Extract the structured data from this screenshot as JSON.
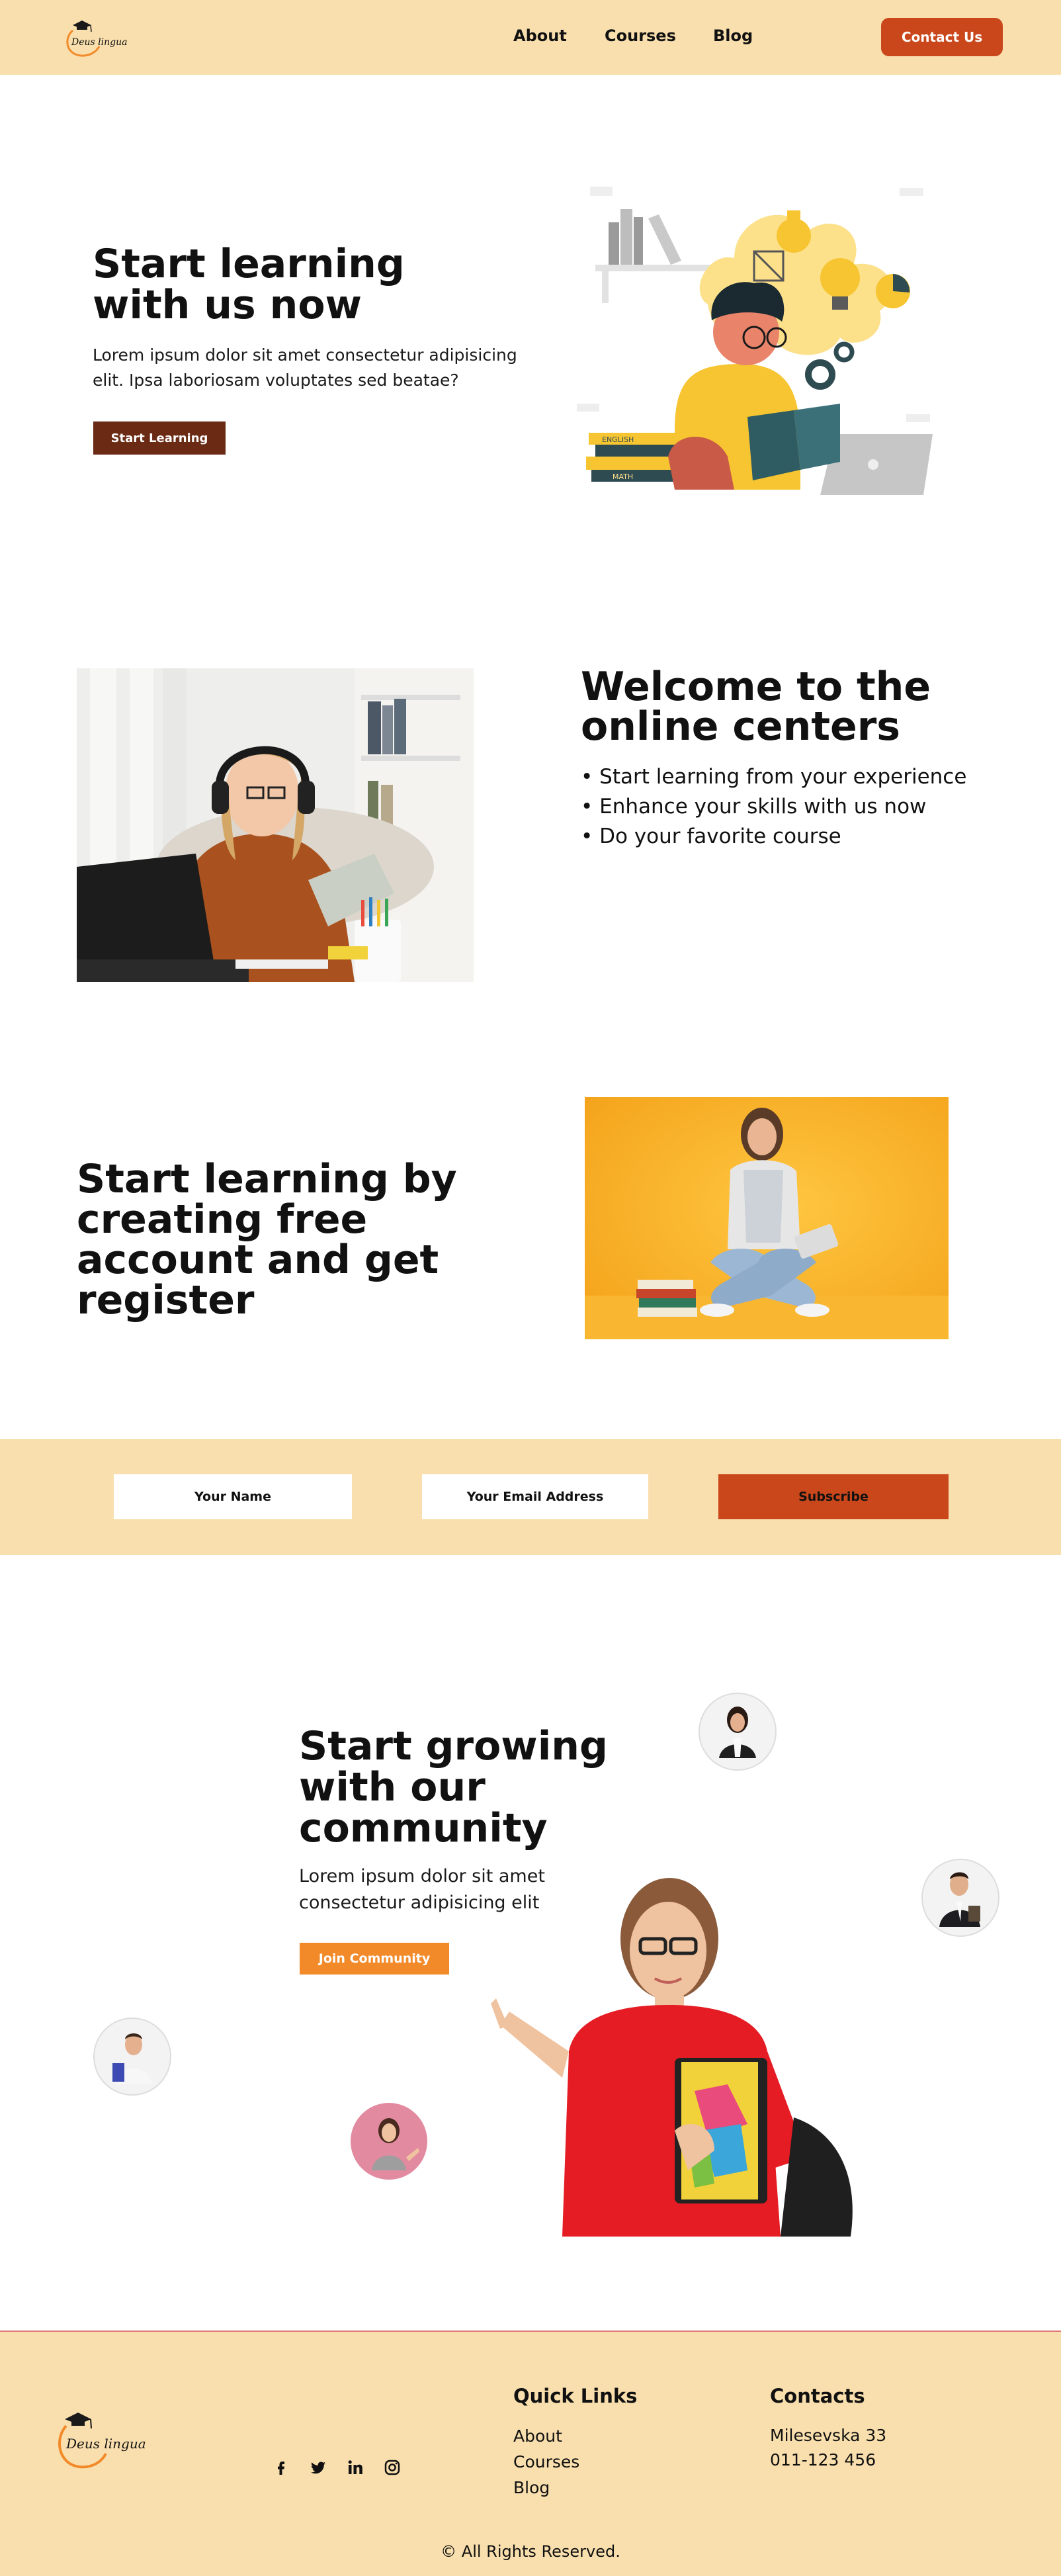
{
  "brand": {
    "name": "Deus lingua"
  },
  "nav": {
    "items": [
      "About",
      "Courses",
      "Blog"
    ],
    "contact_label": "Contact Us"
  },
  "hero": {
    "title": "Start learning with us now",
    "text": "Lorem ipsum dolor sit amet consectetur adipisicing elit. Ipsa laboriosam voluptates sed beatae?",
    "button_label": "Start Learning",
    "book_labels": [
      "ENGLISH",
      "MATH"
    ]
  },
  "welcome": {
    "title": "Welcome to the online centers",
    "features": [
      "• Start learning from your experience",
      "• Enhance your skills with us now",
      "• Do your favorite course"
    ]
  },
  "register": {
    "title": "Start learning by creating free account and get register"
  },
  "subscribe": {
    "name_placeholder": "Your Name",
    "email_placeholder": "Your Email Address",
    "button_label": "Subscribe"
  },
  "community": {
    "title": "Start growing with our community",
    "text": "Lorem ipsum dolor sit amet consectetur adipisicing elit",
    "button_label": "Join Community"
  },
  "footer": {
    "social_icons": [
      "facebook-icon",
      "twitter-icon",
      "linkedin-icon",
      "instagram-icon"
    ],
    "quick_links_title": "Quick Links",
    "quick_links": [
      "About",
      "Courses",
      "Blog"
    ],
    "contacts_title": "Contacts",
    "contacts": [
      "Milesevska 33",
      "011-123 456"
    ],
    "copyright": "©  All Rights Reserved."
  },
  "colors": {
    "accent_bg": "#f9dfad",
    "brand_orange": "#c9471b",
    "dark_brown": "#6b2a14",
    "join_orange": "#f28a2a"
  }
}
